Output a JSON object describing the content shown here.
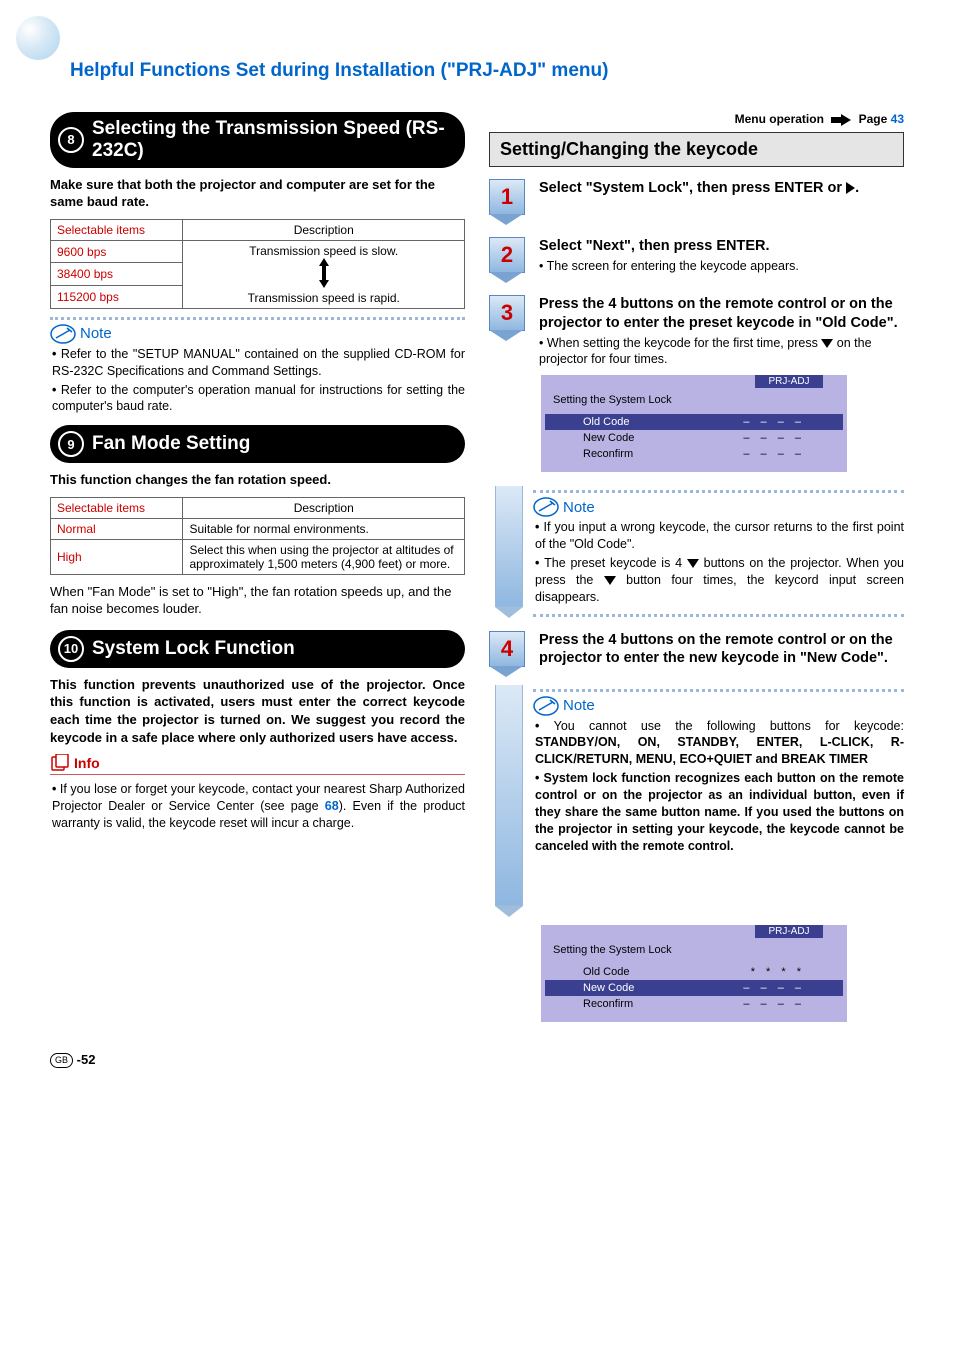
{
  "header_title": "Helpful Functions Set during Installation (\"PRJ-ADJ\" menu)",
  "menu_op": {
    "label": "Menu operation",
    "page_label": "Page",
    "page_num": "43"
  },
  "left": {
    "sec8": {
      "num": "8",
      "title": "Selecting the Transmission Speed (RS-232C)",
      "lead": "Make sure that both the projector and computer are set for the same baud rate.",
      "thead": {
        "c1": "Selectable items",
        "c2": "Description"
      },
      "rows": [
        "9600 bps",
        "38400 bps",
        "115200 bps"
      ],
      "desc_top": "Transmission speed is slow.",
      "desc_bot": "Transmission speed is rapid.",
      "note_label": "Note",
      "notes": [
        "Refer to the \"SETUP MANUAL\" contained on the supplied CD-ROM for RS-232C Specifications and Command Settings.",
        "Refer to the computer's operation manual for instructions for setting the computer's baud rate."
      ]
    },
    "sec9": {
      "num": "9",
      "title": "Fan Mode Setting",
      "lead": "This function changes the fan rotation speed.",
      "thead": {
        "c1": "Selectable items",
        "c2": "Description"
      },
      "rows": [
        {
          "k": "Normal",
          "v": "Suitable for normal environments."
        },
        {
          "k": "High",
          "v": "Select this when using the projector at altitudes of approximately 1,500 meters (4,900 feet) or more."
        }
      ],
      "trail": "When \"Fan Mode\" is set to \"High\", the fan rotation speeds up, and the fan noise becomes louder."
    },
    "sec10": {
      "num": "10",
      "title": "System Lock Function",
      "body1": "This function prevents unauthorized use of the projector. Once this function is activated, users must enter the correct keycode each time the projector is turned on. ",
      "body1b": "We suggest you record the keycode in a safe place where only authorized users have access.",
      "info_label": "Info",
      "info_text": "If you lose or forget your keycode, contact your nearest Sharp Authorized Projector Dealer or Service Center (see page ",
      "info_pg": "68",
      "info_text2": "). Even if the product warranty is valid, the keycode reset will incur a charge."
    }
  },
  "right": {
    "bar_title": "Setting/Changing the keycode",
    "steps": {
      "s1": {
        "n": "1",
        "t1": "Select \"System Lock\", then press ",
        "t2": "ENTER",
        "t3": " or ",
        "t4": "."
      },
      "s2": {
        "n": "2",
        "t1": "Select \"Next\", then press ",
        "t2": "ENTER",
        "t3": ".",
        "sub": "The screen for entering the keycode appears."
      },
      "s3": {
        "n": "3",
        "t": "Press the 4 buttons on the remote control or on the projector to enter the preset keycode in \"Old Code\".",
        "sub": "When setting the keycode for the first time, press ",
        "sub2": " on the projector for four times."
      },
      "s4": {
        "n": "4",
        "t": "Press the 4 buttons on the remote control or on the projector to enter the new keycode in \"New Code\"."
      }
    },
    "osd": {
      "tab": "PRJ-ADJ",
      "title": "Setting the System Lock",
      "rows": [
        {
          "k": "Old Code",
          "v": "– – – –",
          "hl": true
        },
        {
          "k": "New Code",
          "v": "– – – –"
        },
        {
          "k": "Reconfirm",
          "v": "– – – –"
        }
      ]
    },
    "osd2": {
      "tab": "PRJ-ADJ",
      "title": "Setting the System Lock",
      "rows": [
        {
          "k": "Old Code",
          "v": "* * * *"
        },
        {
          "k": "New Code",
          "v": "– – – –",
          "hl": true
        },
        {
          "k": "Reconfirm",
          "v": "– – – –"
        }
      ]
    },
    "note1_label": "Note",
    "note1": [
      "If you input a wrong keycode, the cursor returns to the first point of the \"Old Code\"."
    ],
    "note1b_a": "The preset keycode is 4 ",
    "note1b_b": " buttons on the projector. When you press the ",
    "note1b_c": " button four times, the keycord input screen disappears.",
    "note2_label": "Note",
    "note2": [
      "You cannot use the following buttons for keycode: STANDBY/ON, ON, STANDBY, ENTER, L-CLICK, R-CLICK/RETURN, MENU, ECO+QUIET and BREAK TIMER"
    ],
    "note2b": "System lock function recognizes each button on the remote control or on the projector as an individual button, even if they share the same button name. If you used the buttons on the projector in setting your keycode, the keycode cannot be canceled with the remote control."
  },
  "pagenum": {
    "region": "GB",
    "num": "-52"
  }
}
